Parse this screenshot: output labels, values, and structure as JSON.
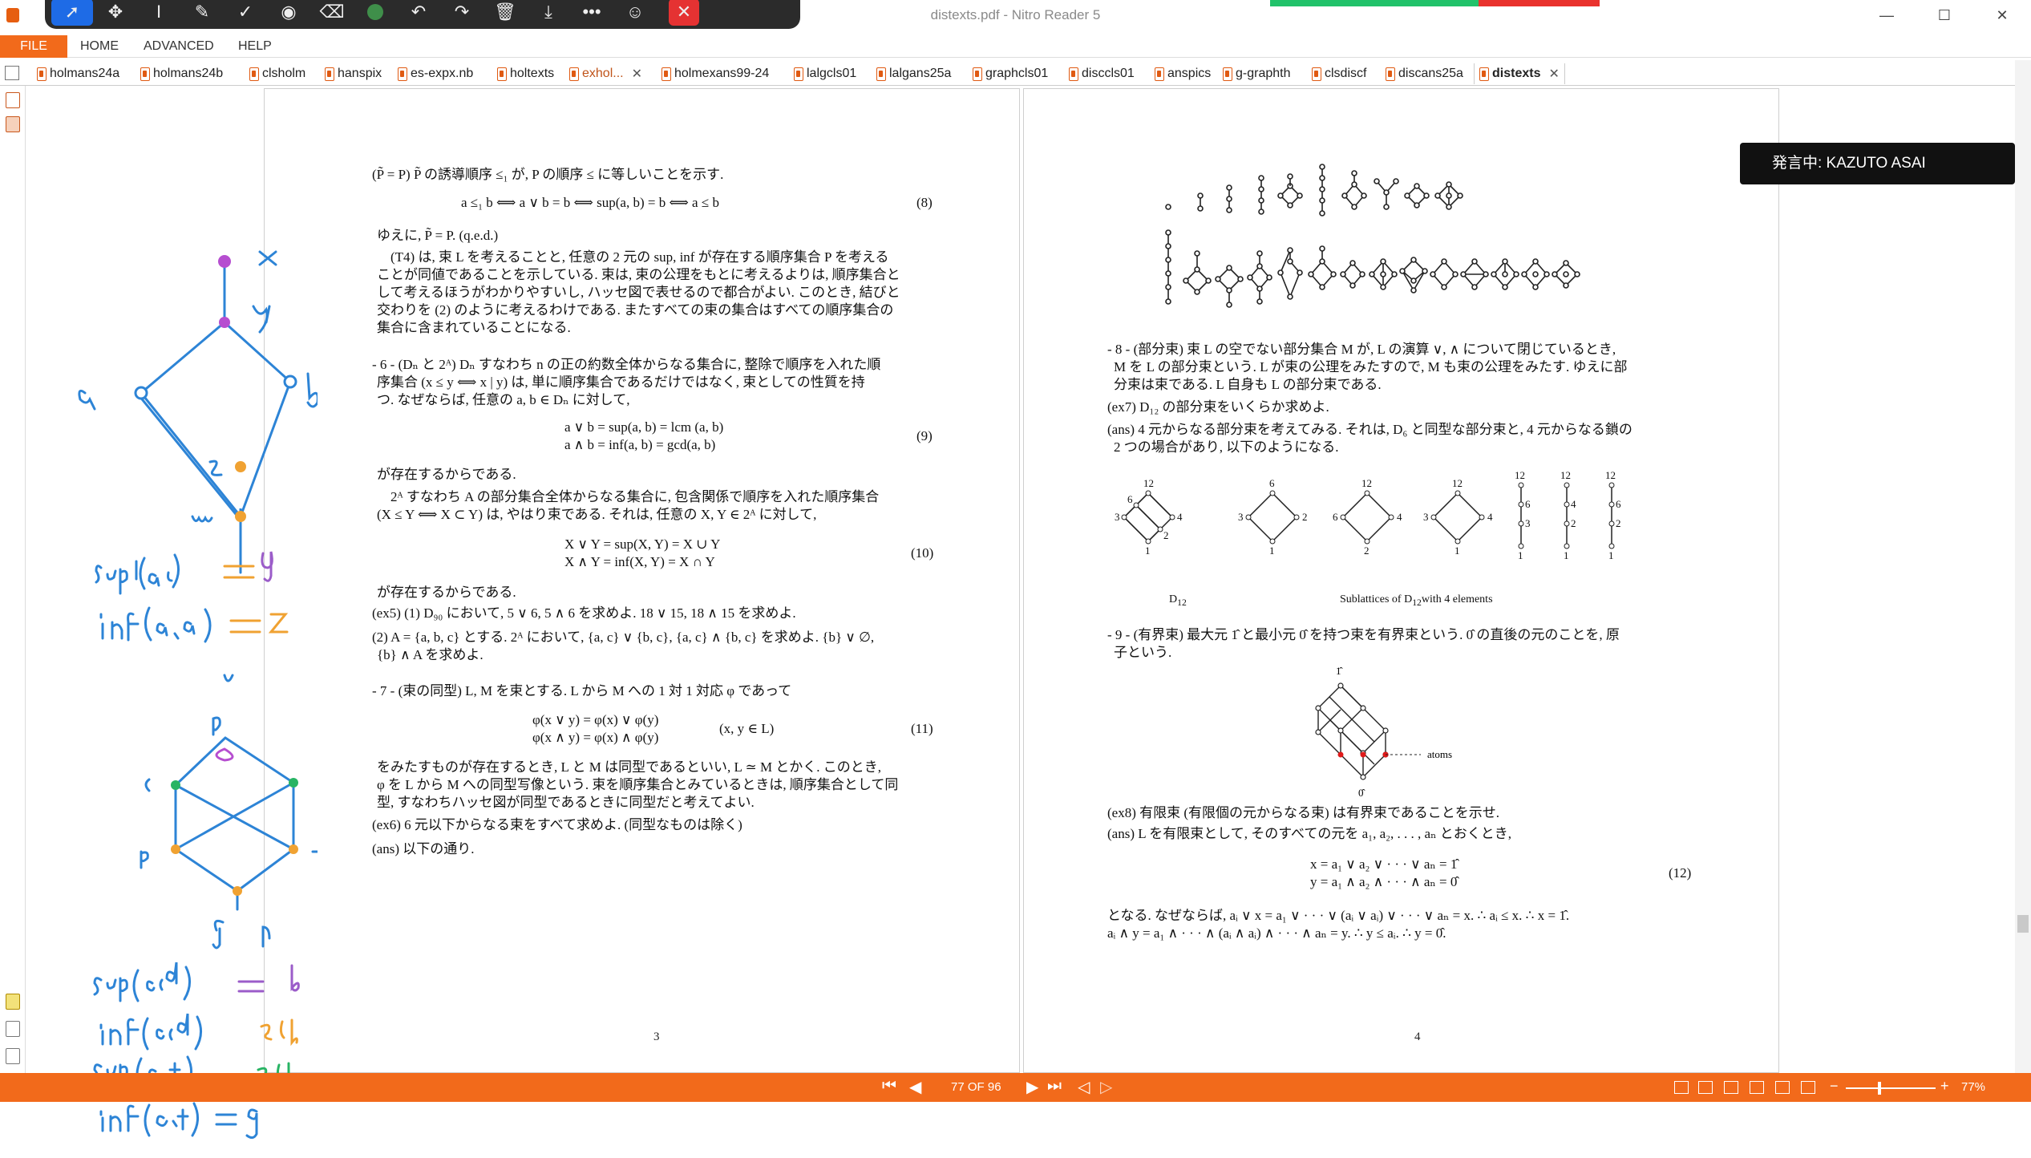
{
  "window": {
    "title": "distexts.pdf - Nitro Reader 5",
    "min": "—",
    "max": "☐",
    "close": "✕"
  },
  "annotation_toolbar": {
    "tools": [
      "select-arrow-icon",
      "move-icon",
      "text-cursor-icon",
      "pen-icon",
      "check-icon",
      "color-dot-icon",
      "highlighter-icon",
      "eraser-icon",
      "undo-icon",
      "redo-icon",
      "trash-icon",
      "download-icon",
      "more-icon",
      "person-icon",
      "close-icon"
    ]
  },
  "ribbon": {
    "file": "FILE",
    "menus": [
      "HOME",
      "ADVANCED",
      "HELP"
    ]
  },
  "tabs": [
    "holmans24a",
    "holmans24b",
    "clsholm",
    "hanspix",
    "es-expx.nb",
    "holtexts",
    "exhol...",
    "holmexans99-24",
    "lalgcls01",
    "lalgans25a",
    "graphcls01",
    "disccls01",
    "anspics",
    "g-graphth",
    "clsdiscf",
    "discans25a",
    "distexts"
  ],
  "speaker": "発言中: KAZUTO ASAI",
  "ink": {
    "top_labels": [
      "x",
      "y",
      "a",
      "b",
      "z",
      "w"
    ],
    "sup1": "sup(a,b) = y",
    "inf1": "inf(a,b) = z",
    "bottom_labels": [
      "a",
      "b",
      "c",
      "d",
      "e",
      "f",
      "g",
      "h"
    ],
    "lines": [
      "sup(c,d) = b",
      "inf(c,d) ?なし",
      "sup(e,f) ?なし",
      "inf(e,f) = g"
    ]
  },
  "page3": {
    "lines": [
      "(P̃ = P) P̃ の誘導順序 ≤₁ が, P の順序 ≤ に等しいことを示す.",
      "ゆえに, P̃ = P.  (q.e.d.)",
      "　(T4) は, 束 L を考えることと, 任意の 2 元の sup, inf が存在する順序集合 P を考える",
      "ことが同値であることを示している. 束は, 束の公理をもとに考えるよりは, 順序集合と",
      "して考えるほうがわかりやすいし, ハッセ図で表せるので都合がよい. このとき, 結びと",
      "交わりを (2) のように考えるわけである. またすべての束の集合はすべての順序集合の",
      "集合に含まれていることになる.",
      "- 6 - (Dₙ と 2ᴬ) Dₙ すなわち n の正の約数全体からなる集合に, 整除で順序を入れた順",
      "序集合 (x ≤ y ⟺ x | y) は, 単に順序集合であるだけではなく, 束としての性質を持",
      "つ. なぜならば, 任意の a, b ∈ Dₙ に対して,",
      "が存在するからである.",
      "　2ᴬ すなわち A の部分集合全体からなる集合に, 包含関係で順序を入れた順序集合",
      "(X ≤ Y ⟺ X ⊂ Y) は, やはり束である. それは, 任意の X, Y ∈ 2ᴬ に対して,",
      "が存在するからである.",
      "(ex5) (1) D₉₀ において, 5 ∨ 6, 5 ∧ 6 を求めよ. 18 ∨ 15, 18 ∧ 15 を求めよ.",
      "(2) A = {a, b, c} とする. 2ᴬ において, {a, c} ∨ {b, c}, {a, c} ∧ {b, c} を求めよ. {b} ∨ ∅,",
      "{b} ∧ A を求めよ.",
      "- 7 - (束の同型) L, M を束とする. L から M への 1 対 1 対応 φ であって",
      "をみたすものが存在するとき, L と M は同型であるといい, L ≃ M とかく. このとき,",
      "φ を L から M への同型写像という. 束を順序集合とみているときは, 順序集合として同",
      "型, すなわちハッセ図が同型であるときに同型だと考えてよい.",
      "(ex6) 6 元以下からなる束をすべて求めよ. (同型なものは除く)",
      "(ans) 以下の通り."
    ],
    "eq8": "a ≤₁ b ⟺ a ∨ b = b ⟺ sup(a, b) = b ⟺ a ≤ b",
    "eq9a": "a ∨ b = sup(a, b) = lcm (a, b)",
    "eq9b": "a ∧ b = inf(a, b) = gcd(a, b)",
    "eq10a": "X ∨ Y = sup(X, Y) = X ∪ Y",
    "eq10b": "X ∧ Y = inf(X, Y) = X ∩ Y",
    "eq11a": "φ(x ∨ y) = φ(x) ∨ φ(y)",
    "eq11b": "φ(x ∧ y) = φ(x) ∧ φ(y)",
    "eq11c": "(x, y ∈ L)",
    "n8": "(8)",
    "n9": "(9)",
    "n10": "(10)",
    "n11": "(11)",
    "num": "3"
  },
  "page4": {
    "lines": [
      "- 8 - (部分束) 束 L の空でない部分集合 M が, L の演算 ∨, ∧ について閉じているとき,",
      "M を L の部分束という. L が束の公理をみたすので, M も束の公理をみたす. ゆえに部",
      "分束は束である. L 自身も L の部分束である.",
      "(ex7) D₁₂ の部分束をいくらか求めよ.",
      "(ans) 4 元からなる部分束を考えてみる. それは, D₆ と同型な部分束と, 4 元からなる鎖の",
      "2 つの場合があり, 以下のようになる.",
      "- 9 - (有界束) 最大元 1̂ と最小元 0̂ を持つ束を有界束という. 0̂ の直後の元のことを, 原",
      "子という.",
      "(ex8) 有限束 (有限個の元からなる束) は有界束であることを示せ.",
      "(ans) L を有限束として, そのすべての元を a₁, a₂, . . . , aₙ とおくとき,",
      "となる. なぜならば, aᵢ ∨ x = a₁ ∨ · · · ∨ (aᵢ ∨ aᵢ) ∨ · · · ∨ aₙ = x. ∴ aᵢ ≤ x. ∴ x = 1̂.",
      "aᵢ ∧ y = a₁ ∧ · · · ∧ (aᵢ ∧ aᵢ) ∧ · · · ∧ aₙ = y. ∴ y ≤ aᵢ. ∴ y = 0̂."
    ],
    "eq12a": "x = a₁ ∨ a₂ ∨ · · · ∨ aₙ = 1̂",
    "eq12b": "y = a₁ ∧ a₂ ∧ · · · ∧ aₙ = 0̂",
    "n12": "(12)",
    "cap1": "D",
    "cap1sub": "12",
    "cap2": "Sublattices of D",
    "cap2sub": "12",
    "cap2b": "with 4 elements",
    "atoms": "atoms",
    "top": "1̂",
    "bot": "0̂",
    "d12": [
      "12",
      "6",
      "4",
      "3",
      "2",
      "1"
    ],
    "num": "4"
  },
  "status": {
    "page": "77 OF 96",
    "zoom": "77%",
    "minus": "−",
    "plus": "+"
  }
}
